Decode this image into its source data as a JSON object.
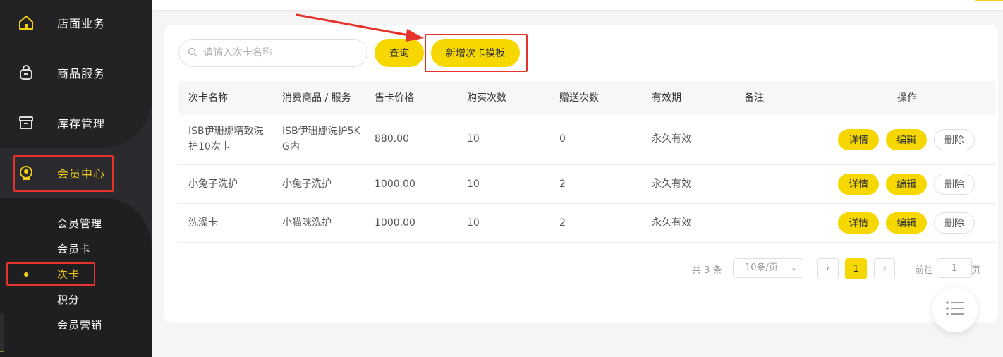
{
  "sidebar": {
    "items": [
      {
        "label": "店面业务",
        "icon": "home-icon"
      },
      {
        "label": "商品服务",
        "icon": "bag-icon"
      },
      {
        "label": "库存管理",
        "icon": "box-icon"
      },
      {
        "label": "会员中心",
        "icon": "member-icon"
      }
    ],
    "sub_items": [
      {
        "label": "会员管理"
      },
      {
        "label": "会员卡"
      },
      {
        "label": "次卡"
      },
      {
        "label": "积分"
      },
      {
        "label": "会员营销"
      }
    ],
    "accent_color": "#f5cf14"
  },
  "toolbar": {
    "search_placeholder": "请输入次卡名称",
    "query_label": "查询",
    "add_label": "新增次卡模板"
  },
  "table": {
    "headers": [
      "次卡名称",
      "消费商品 / 服务",
      "售卡价格",
      "购买次数",
      "赠送次数",
      "有效期",
      "备注",
      "操作"
    ],
    "rows": [
      {
        "name": "ISB伊珊娜精致洗护10次卡",
        "name_l1": "ISB伊珊娜精致洗",
        "name_l2": "护10次卡",
        "service": "ISB伊珊娜洗护5KG内",
        "service_l1": "ISB伊珊娜洗护5K",
        "service_l2": "G内",
        "price": "880.00",
        "buy": "10",
        "gift": "0",
        "validity": "永久有效",
        "note": ""
      },
      {
        "name": "小兔子洗护",
        "service": "小兔子洗护",
        "price": "1000.00",
        "buy": "10",
        "gift": "2",
        "validity": "永久有效",
        "note": ""
      },
      {
        "name": "洗澡卡",
        "service": "小猫咪洗护",
        "price": "1000.00",
        "buy": "10",
        "gift": "2",
        "validity": "永久有效",
        "note": ""
      }
    ],
    "ops": {
      "detail": "详情",
      "edit": "编辑",
      "delete": "删除"
    }
  },
  "pagination": {
    "total_text": "共 3 条",
    "page_size": "10条/页",
    "current_page": "1",
    "goto_label": "前往",
    "goto_value": "1",
    "page_suffix": "页"
  },
  "colors": {
    "brand_yellow": "#f7d700",
    "sidebar_bg": "#2b2b2f",
    "annotation_red": "#e5322d"
  }
}
